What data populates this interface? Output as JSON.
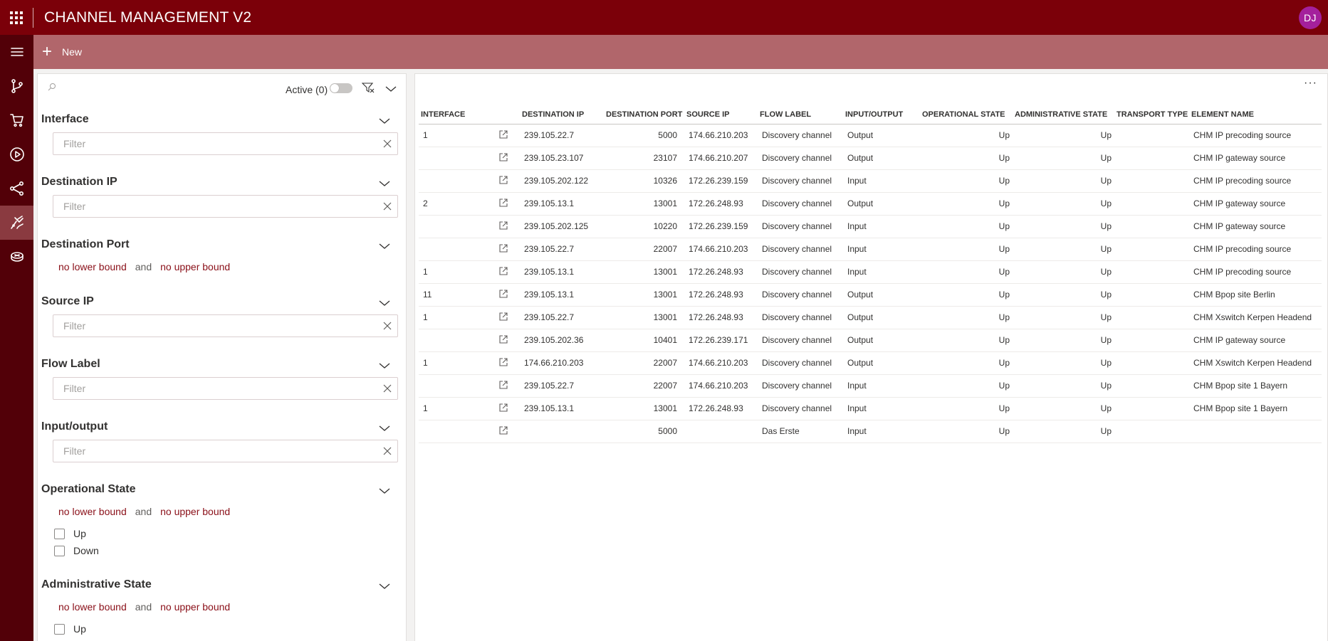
{
  "app": {
    "title": "CHANNEL MANAGEMENT V2",
    "user_initials": "DJ"
  },
  "rail": {
    "items": [
      "menu-icon",
      "branch-icon",
      "cart-icon",
      "play-icon",
      "share-icon",
      "flask-icon",
      "router-icon"
    ]
  },
  "cmdbar": {
    "new_label": "New"
  },
  "filters": {
    "active_label": "Active (0)",
    "filter_placeholder": "Filter",
    "interface": {
      "title": "Interface"
    },
    "destination_ip": {
      "title": "Destination IP"
    },
    "destination_port": {
      "title": "Destination Port",
      "lower": "no lower bound",
      "and": "and",
      "upper": "no upper bound"
    },
    "source_ip": {
      "title": "Source IP"
    },
    "flow_label": {
      "title": "Flow Label"
    },
    "input_output": {
      "title": "Input/output"
    },
    "operational_state": {
      "title": "Operational State",
      "lower": "no lower bound",
      "and": "and",
      "upper": "no upper bound",
      "options": [
        "Up",
        "Down"
      ]
    },
    "administrative_state": {
      "title": "Administrative State",
      "lower": "no lower bound",
      "and": "and",
      "upper": "no upper bound",
      "options": [
        "Up"
      ]
    }
  },
  "table": {
    "more_label": "···",
    "columns": [
      "INTERFACE",
      "",
      "DESTINATION IP",
      "DESTINATION PORT",
      "SOURCE IP",
      "FLOW LABEL",
      "INPUT/OUTPUT",
      "OPERATIONAL STATE",
      "ADMINISTRATIVE STATE",
      "TRANSPORT TYPE",
      "ELEMENT NAME"
    ],
    "rows": [
      [
        "1",
        "239.105.22.7",
        "5000",
        "174.66.210.203",
        "Discovery channel",
        "Output",
        "Up",
        "Up",
        "",
        "CHM IP precoding source"
      ],
      [
        "",
        "239.105.23.107",
        "23107",
        "174.66.210.207",
        "Discovery channel",
        "Output",
        "Up",
        "Up",
        "",
        "CHM IP gateway source"
      ],
      [
        "",
        "239.105.202.122",
        "10326",
        "172.26.239.159",
        "Discovery channel",
        "Input",
        "Up",
        "Up",
        "",
        "CHM IP precoding source"
      ],
      [
        "2",
        "239.105.13.1",
        "13001",
        "172.26.248.93",
        "Discovery channel",
        "Output",
        "Up",
        "Up",
        "",
        "CHM IP gateway source"
      ],
      [
        "",
        "239.105.202.125",
        "10220",
        "172.26.239.159",
        "Discovery channel",
        "Input",
        "Up",
        "Up",
        "",
        "CHM IP gateway source"
      ],
      [
        "",
        "239.105.22.7",
        "22007",
        "174.66.210.203",
        "Discovery channel",
        "Input",
        "Up",
        "Up",
        "",
        "CHM IP precoding source"
      ],
      [
        "1",
        "239.105.13.1",
        "13001",
        "172.26.248.93",
        "Discovery channel",
        "Input",
        "Up",
        "Up",
        "",
        "CHM IP precoding source"
      ],
      [
        "11",
        "239.105.13.1",
        "13001",
        "172.26.248.93",
        "Discovery channel",
        "Output",
        "Up",
        "Up",
        "",
        "CHM Bpop site Berlin"
      ],
      [
        "1",
        "239.105.22.7",
        "13001",
        "172.26.248.93",
        "Discovery channel",
        "Output",
        "Up",
        "Up",
        "",
        "CHM Xswitch Kerpen Headend"
      ],
      [
        "",
        "239.105.202.36",
        "10401",
        "172.26.239.171",
        "Discovery channel",
        "Output",
        "Up",
        "Up",
        "",
        "CHM IP gateway source"
      ],
      [
        "1",
        "174.66.210.203",
        "22007",
        "174.66.210.203",
        "Discovery channel",
        "Output",
        "Up",
        "Up",
        "",
        "CHM Xswitch Kerpen Headend"
      ],
      [
        "",
        "239.105.22.7",
        "22007",
        "174.66.210.203",
        "Discovery channel",
        "Input",
        "Up",
        "Up",
        "",
        "CHM Bpop site 1 Bayern"
      ],
      [
        "1",
        "239.105.13.1",
        "13001",
        "172.26.248.93",
        "Discovery channel",
        "Input",
        "Up",
        "Up",
        "",
        "CHM Bpop site 1 Bayern"
      ],
      [
        "",
        "",
        "5000",
        "",
        "Das Erste",
        "Input",
        "Up",
        "Up",
        "",
        ""
      ]
    ]
  }
}
